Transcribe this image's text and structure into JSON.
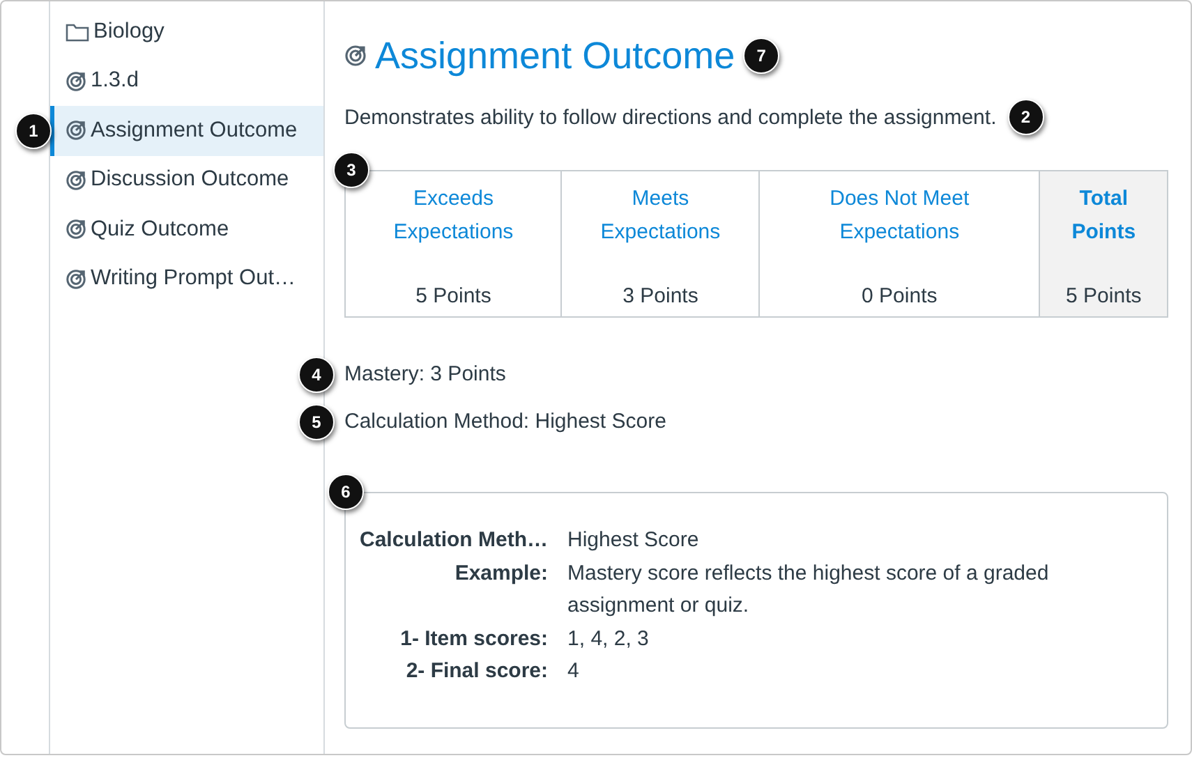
{
  "sidebar": {
    "badge": "1",
    "items": [
      {
        "label": "Biology",
        "kind": "folder",
        "selected": false
      },
      {
        "label": "1.3.d",
        "kind": "outcome",
        "selected": false
      },
      {
        "label": "Assignment Outcome",
        "kind": "outcome",
        "selected": true
      },
      {
        "label": "Discussion Outcome",
        "kind": "outcome",
        "selected": false
      },
      {
        "label": "Quiz Outcome",
        "kind": "outcome",
        "selected": false
      },
      {
        "label": "Writing Prompt Out…",
        "kind": "outcome",
        "selected": false
      }
    ]
  },
  "outcome": {
    "title": "Assignment Outcome",
    "title_badge": "7",
    "description": "Demonstrates ability to follow directions and complete the assignment.",
    "description_badge": "2",
    "ratings": {
      "badge": "3",
      "columns": [
        {
          "title": "Exceeds Expectations",
          "points": "5 Points",
          "kind": "rating"
        },
        {
          "title": "Meets Expectations",
          "points": "3 Points",
          "kind": "rating"
        },
        {
          "title": "Does Not Meet Expectations",
          "points": "0 Points",
          "kind": "rating"
        },
        {
          "title": "Total Points",
          "points": "5 Points",
          "kind": "total"
        }
      ]
    },
    "mastery": {
      "text": "Mastery: 3 Points",
      "badge": "4"
    },
    "calculation": {
      "text": "Calculation Method: Highest Score",
      "badge": "5"
    },
    "details": {
      "badge": "6",
      "rows": [
        {
          "label": "Calculation Meth…",
          "value": "Highest Score"
        },
        {
          "label": "Example:",
          "value": "Mastery score reflects the highest score of a graded assignment or quiz."
        },
        {
          "label": "1- Item scores:",
          "value": "1, 4, 2, 3"
        },
        {
          "label": "2- Final score:",
          "value": "4"
        }
      ]
    }
  }
}
